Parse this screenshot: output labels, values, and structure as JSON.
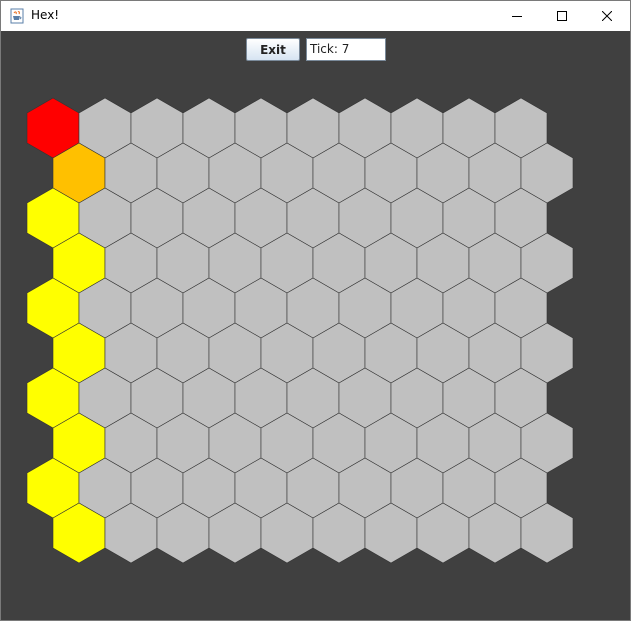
{
  "window": {
    "title": "Hex!",
    "app_icon": "java-coffee-cup-icon",
    "controls": [
      "minimize-icon",
      "maximize-icon",
      "close-icon"
    ]
  },
  "toolbar": {
    "exit_label": "Exit",
    "tick_value": "Tick: 7"
  },
  "board": {
    "rows": 10,
    "cols": 10,
    "colors": {
      "empty": "#c0c0c0",
      "red": "#ff0000",
      "orange": "#ffc000",
      "yellow": "#ffff00",
      "outline": "#333333",
      "background": "#404040"
    },
    "colored_cells": [
      {
        "row": 0,
        "col": 0,
        "color": "red"
      },
      {
        "row": 1,
        "col": 0,
        "color": "orange"
      },
      {
        "row": 2,
        "col": 0,
        "color": "yellow"
      },
      {
        "row": 3,
        "col": 0,
        "color": "yellow"
      },
      {
        "row": 4,
        "col": 0,
        "color": "yellow"
      },
      {
        "row": 5,
        "col": 0,
        "color": "yellow"
      },
      {
        "row": 6,
        "col": 0,
        "color": "yellow"
      },
      {
        "row": 7,
        "col": 0,
        "color": "yellow"
      },
      {
        "row": 8,
        "col": 0,
        "color": "yellow"
      },
      {
        "row": 9,
        "col": 0,
        "color": "yellow"
      }
    ]
  }
}
